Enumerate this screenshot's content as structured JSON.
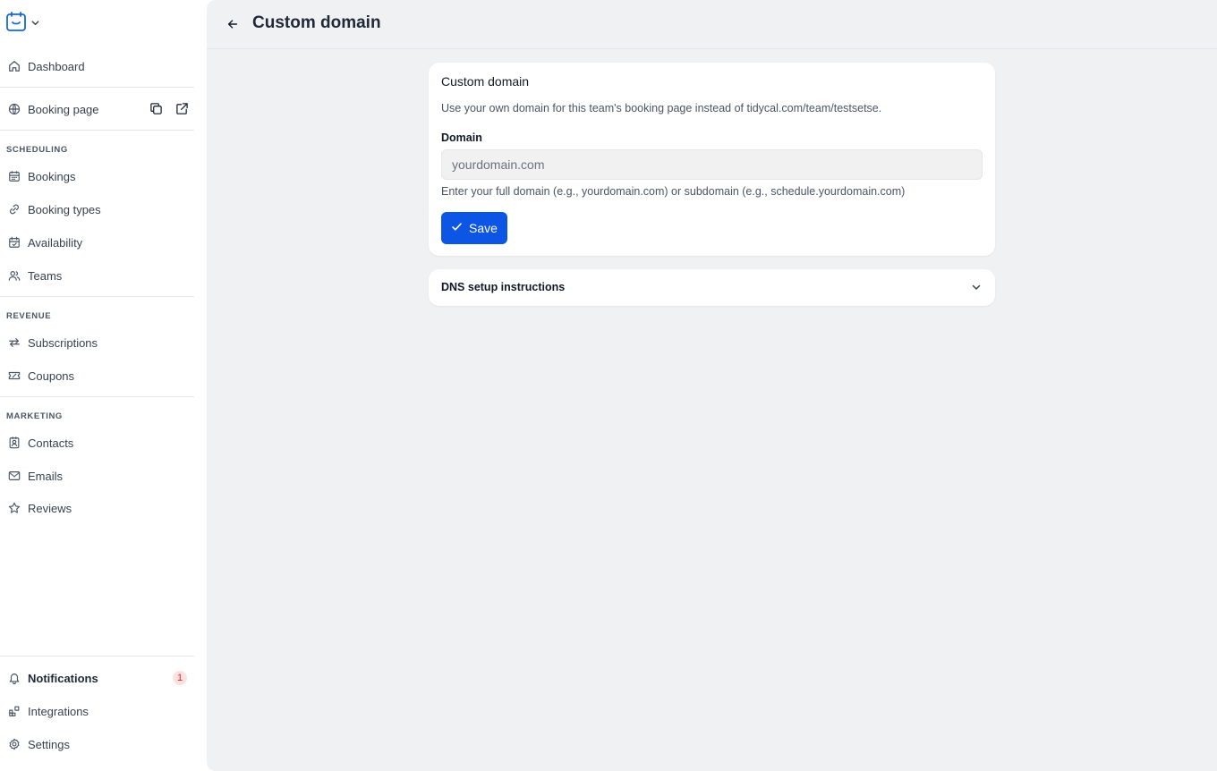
{
  "colors": {
    "accent": "#0d55e4",
    "badge_text": "#dc2626",
    "badge_bg": "#fde2e2"
  },
  "sidebar": {
    "dashboard": "Dashboard",
    "booking_page": "Booking page",
    "sections": {
      "scheduling": "SCHEDULING",
      "revenue": "REVENUE",
      "marketing": "MARKETING"
    },
    "scheduling_items": [
      "Bookings",
      "Booking types",
      "Availability",
      "Teams"
    ],
    "revenue_items": [
      "Subscriptions",
      "Coupons"
    ],
    "marketing_items": [
      "Contacts",
      "Emails",
      "Reviews"
    ],
    "notifications": {
      "label": "Notifications",
      "count": "1"
    },
    "integrations": "Integrations",
    "settings": "Settings"
  },
  "header": {
    "title": "Custom domain"
  },
  "custom_domain_card": {
    "title": "Custom domain",
    "description": "Use your own domain for this team's booking page instead of tidycal.com/team/testsetse.",
    "field_label": "Domain",
    "field_placeholder": "yourdomain.com",
    "field_value": "",
    "help": "Enter your full domain (e.g., yourdomain.com) or subdomain (e.g., schedule.yourdomain.com)",
    "save_label": "Save"
  },
  "dns_card": {
    "title": "DNS setup instructions"
  }
}
